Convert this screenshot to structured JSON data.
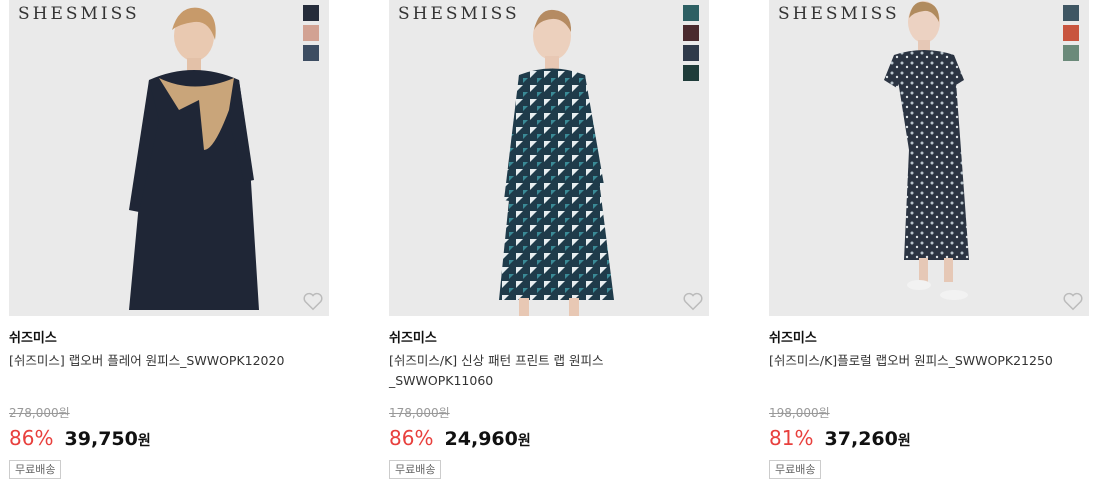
{
  "products": [
    {
      "brand_logo": "SHESMISS",
      "swatch_colors": [
        "#252c3a",
        "#d2a293",
        "#3d4d62"
      ],
      "brand": "쉬즈미스",
      "title": "[쉬즈미스] 랩오버 플레어 원피스_SWWOPK12020",
      "original_price": "278,000원",
      "discount": "86%",
      "price": "39,750",
      "currency": "원",
      "badge": "무료배송",
      "dress_color": "#1f2636",
      "accent_color": "#c9a57a"
    },
    {
      "brand_logo": "SHESMISS",
      "swatch_colors": [
        "#2d5f63",
        "#4a2a2e",
        "#2f3a4a",
        "#1f3c3a"
      ],
      "brand": "쉬즈미스",
      "title": "[쉬즈미스/K] 신상 패턴 프린트 랩 원피스_SWWOPK11060",
      "original_price": "178,000원",
      "discount": "86%",
      "price": "24,960",
      "currency": "원",
      "badge": "무료배송",
      "dress_color": "#1f3b4a",
      "accent_color": "#e8eef0"
    },
    {
      "brand_logo": "SHESMISS",
      "swatch_colors": [
        "#3f5663",
        "#c8553f",
        "#6b8a7a"
      ],
      "brand": "쉬즈미스",
      "title": "[쉬즈미스/K]플로럴 랩오버 원피스_SWWOPK21250",
      "original_price": "198,000원",
      "discount": "81%",
      "price": "37,260",
      "currency": "원",
      "badge": "무료배송",
      "dress_color": "#2b3442",
      "accent_color": "#b8c4cc"
    }
  ]
}
